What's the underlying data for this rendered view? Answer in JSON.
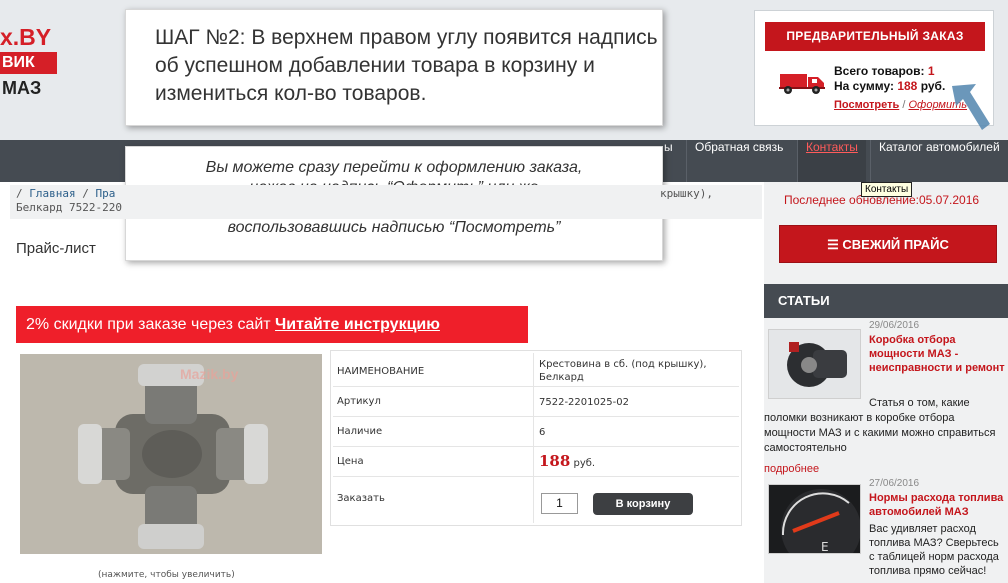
{
  "logo": {
    "line1": "x.BY",
    "line2": "ВИК",
    "line3": "МАЗ"
  },
  "cart": {
    "preorder_label": "ПРЕДВАРИТЕЛЬНЫЙ ЗАКАЗ",
    "total_items_label": "Всего товаров:",
    "total_items_value": "1",
    "sum_label": "На сумму:",
    "sum_value": "188",
    "currency": "руб.",
    "view_link": "Посмотреть",
    "separator": "/",
    "checkout_link": "Оформить"
  },
  "callout1": {
    "text": "ШАГ №2: В верхнем правом углу появится надпись об успешном добавлении товара в корзину и измениться кол-во товаров."
  },
  "callout2": {
    "text": "Вы можете сразу перейти к оформлению заказа, нажав на надпись “Оформить” или же посмотреть содержимое корзины, воспользовавшись надписью “Посмотреть”"
  },
  "nav": {
    "items": [
      "ы",
      "Обратная связь",
      "Контакты",
      "Каталог автомобилей"
    ],
    "tooltip": "Контакты"
  },
  "breadcrumb": {
    "home": "Главная",
    "sep": "/",
    "partial": "Пра",
    "tail": "крышку),",
    "line2": "Белкард 7522-220"
  },
  "page_title": "Прайс-лист",
  "promo": {
    "text": "2% скидки при заказе через сайт ",
    "link": "Читайте инструкцию"
  },
  "photo": {
    "watermark": "Mazik.by",
    "zoom_hint": "(нажмите, чтобы увеличить)"
  },
  "product": {
    "name_label": "НАИМЕНОВАНИЕ",
    "name_value": "Крестовина в сб. (под крышку), Белкард",
    "article_label": "Артикул",
    "article_value": "7522-2201025-02",
    "stock_label": "Наличие",
    "stock_value": "6",
    "price_label": "Цена",
    "price_value": "188",
    "price_currency": "руб.",
    "order_label": "Заказать",
    "qty_value": "1",
    "cart_button": "В корзину"
  },
  "sidebar": {
    "updated": "Последнее обновление:05.07.2016",
    "fresh_price": "СВЕЖИЙ ПРАЙС",
    "articles_title": "СТАТЬИ",
    "articles": [
      {
        "date": "29/06/2016",
        "title": "Коробка отбора мощности МАЗ - неисправности и ремонт",
        "desc": "Статья о том, какие поломки возникают в коробке отбора мощности МАЗ и с какими можно справиться самостоятельно",
        "more": "подробнее"
      },
      {
        "date": "27/06/2016",
        "title": "Нормы расхода топлива автомобилей МАЗ",
        "desc": "Вас удивляет расход топлива МАЗ? Сверьтесь с таблицей норм расхода топлива прямо сейчас!"
      }
    ]
  },
  "colors": {
    "accent": "#c4161c",
    "nav_bg": "#454b52",
    "promo": "#ef1f2a"
  }
}
